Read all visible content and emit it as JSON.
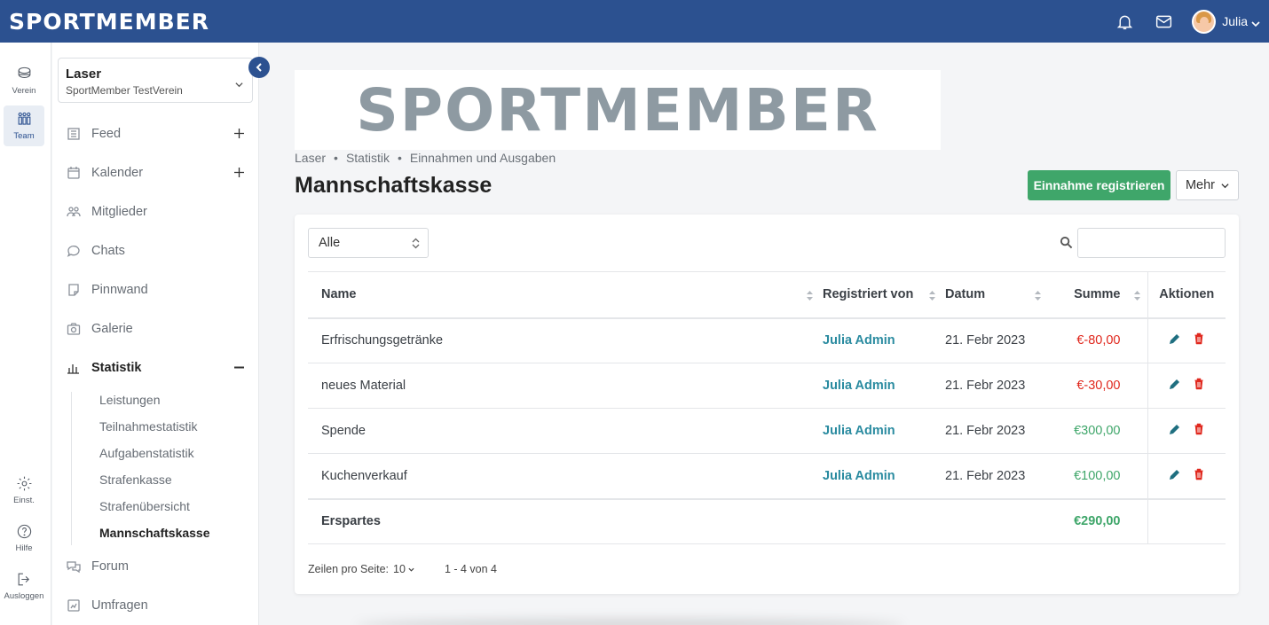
{
  "app": {
    "brand": "SPORTMEMBER",
    "user_name": "Julia"
  },
  "rail": {
    "verein": "Verein",
    "team": "Team",
    "einst": "Einst.",
    "hilfe": "Hilfe",
    "ausloggen": "Ausloggen"
  },
  "team_select": {
    "name": "Laser",
    "club": "SportMember TestVerein"
  },
  "nav": {
    "feed": "Feed",
    "kalender": "Kalender",
    "mitglieder": "Mitglieder",
    "chats": "Chats",
    "pinnwand": "Pinnwand",
    "galerie": "Galerie",
    "statistik": "Statistik",
    "forum": "Forum",
    "umfragen": "Umfragen",
    "sub": [
      "Leistungen",
      "Teilnahmestatistik",
      "Aufgabenstatistik",
      "Strafenkasse",
      "Strafenübersicht",
      "Mannschaftskasse"
    ]
  },
  "main": {
    "logo_text": "SPORTMEMBER",
    "breadcrumb": [
      "Laser",
      "Statistik",
      "Einnahmen und Ausgaben"
    ],
    "title": "Mannschaftskasse",
    "primary_button": "Einnahme registrieren",
    "more_button": "Mehr",
    "filter_value": "Alle",
    "search_value": ""
  },
  "table": {
    "headers": {
      "name": "Name",
      "registered_by": "Registriert von",
      "date": "Datum",
      "sum": "Summe",
      "actions": "Aktionen"
    },
    "rows": [
      {
        "name": "Erfrischungsgetränke",
        "registered_by": "Julia Admin",
        "date": "21. Febr 2023",
        "sum": "€-80,00",
        "type": "negative"
      },
      {
        "name": "neues Material",
        "registered_by": "Julia Admin",
        "date": "21. Febr 2023",
        "sum": "€-30,00",
        "type": "negative"
      },
      {
        "name": "Spende",
        "registered_by": "Julia Admin",
        "date": "21. Febr 2023",
        "sum": "€300,00",
        "type": "positive"
      },
      {
        "name": "Kuchenverkauf",
        "registered_by": "Julia Admin",
        "date": "21. Febr 2023",
        "sum": "€100,00",
        "type": "positive"
      }
    ],
    "total": {
      "label": "Erspartes",
      "sum": "€290,00"
    }
  },
  "pager": {
    "rows_per_page_label": "Zeilen pro Seite:",
    "rows_per_page_value": "10",
    "range": "1 - 4 von 4"
  },
  "colors": {
    "topbar": "#2c5190",
    "primary_button": "#3fa66a",
    "link": "#2a8ba0",
    "negative": "#e0281e",
    "positive": "#3fa66a"
  },
  "icons": [
    "bell-icon",
    "mail-icon",
    "chevron-down-icon",
    "search-icon",
    "edit-icon",
    "delete-icon",
    "sort-icon"
  ]
}
